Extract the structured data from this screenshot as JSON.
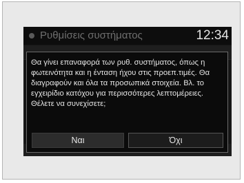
{
  "header": {
    "title": "Ρυθμίσεις συστήματος",
    "icon": "settings-dot-icon",
    "clock": "12:34"
  },
  "dialog": {
    "message": "Θα γίνει επαναφορά των ρυθ. συστήματος, όπως η φωτεινότητα και η ένταση ήχου στις προεπ.τιμές. Θα διαγραφούν και όλα τα προσωπικά στοιχεία. Βλ. το εγχειρίδιο κατόχου για περισσότερες λεπτομέρειες. Θέλετε να συνεχίσετε;",
    "yes_label": "Ναι",
    "no_label": "Όχι"
  }
}
